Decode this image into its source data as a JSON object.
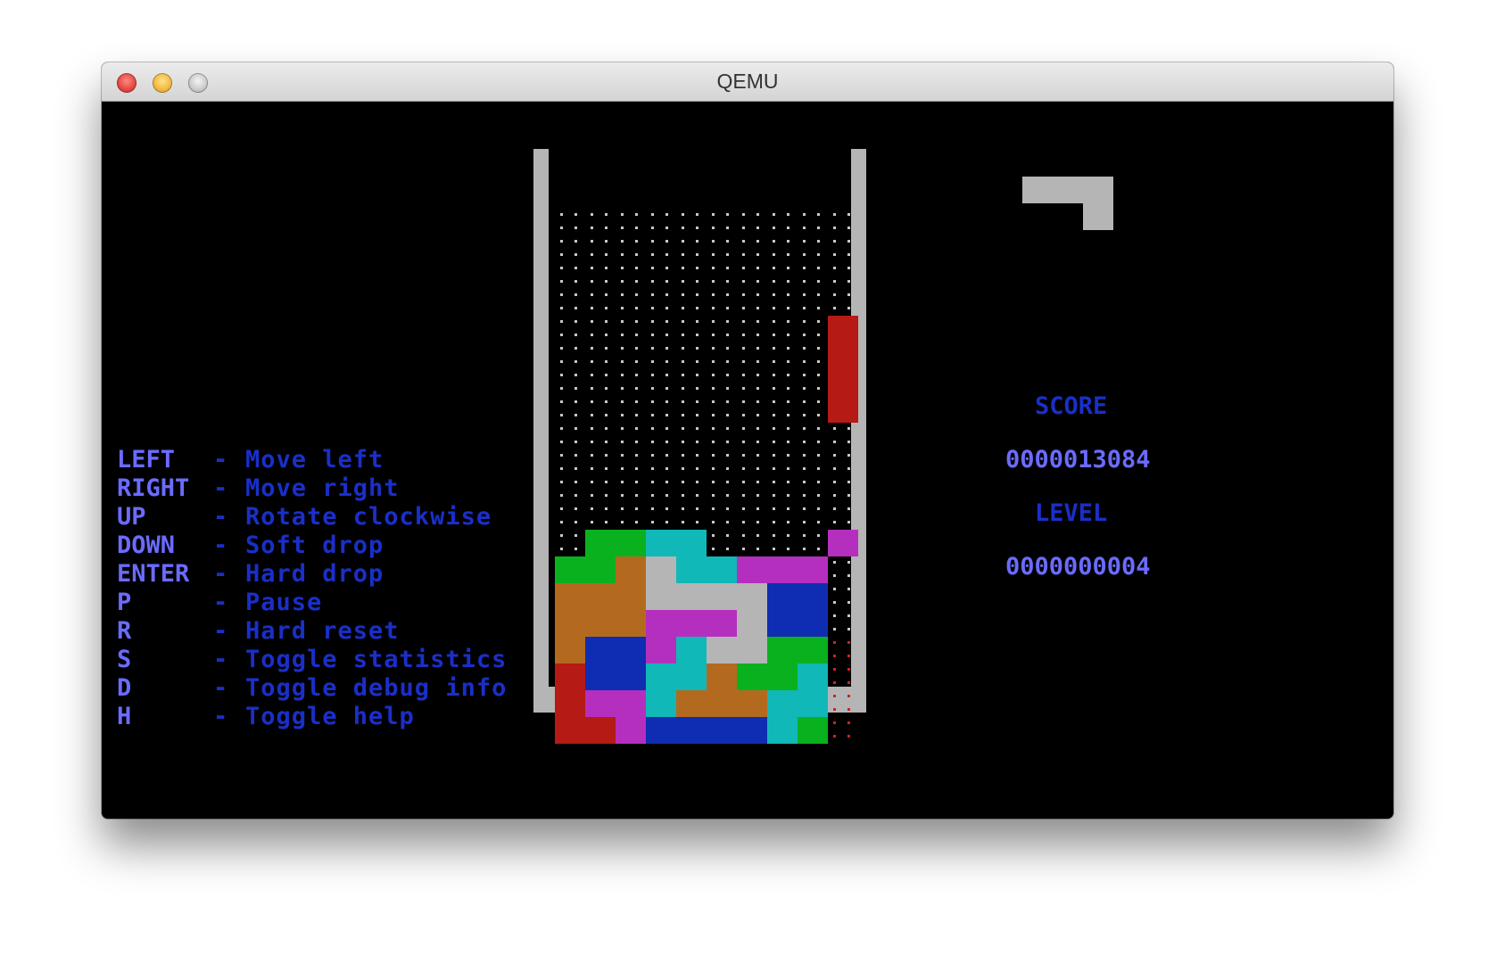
{
  "window": {
    "title": "QEMU"
  },
  "help": [
    {
      "key": "LEFT",
      "dash": "-",
      "desc": "Move left"
    },
    {
      "key": "RIGHT",
      "dash": "-",
      "desc": "Move right"
    },
    {
      "key": "UP",
      "dash": "-",
      "desc": "Rotate clockwise"
    },
    {
      "key": "DOWN",
      "dash": "-",
      "desc": "Soft drop"
    },
    {
      "key": "ENTER",
      "dash": "-",
      "desc": "Hard drop"
    },
    {
      "key": "P",
      "dash": "-",
      "desc": "Pause"
    },
    {
      "key": "R",
      "dash": "-",
      "desc": "Hard reset"
    },
    {
      "key": "S",
      "dash": "-",
      "desc": "Toggle statistics"
    },
    {
      "key": "D",
      "dash": "-",
      "desc": "Toggle debug info"
    },
    {
      "key": "H",
      "dash": "-",
      "desc": "Toggle help"
    }
  ],
  "stats": {
    "score_label": "SCORE",
    "score_value": "0000013084",
    "level_label": "LEVEL",
    "level_value": "0000000004"
  },
  "colors": {
    "border": "#b5b5b5",
    "dot": "#c8c8c8",
    "ghost_dot": "#d42020",
    "G": "#0ab11e",
    "C": "#10b8b8",
    "M": "#b52fbe",
    "O": "#b46a1e",
    "W": "#b5b5b5",
    "B": "#0f2db2",
    "R": "#b51a14"
  },
  "board": {
    "columns": 10,
    "rows": 20,
    "cells": [
      "..........",
      "..........",
      "..........",
      "..........",
      "..........",
      "..........",
      "..........",
      "..........",
      "..........",
      "..........",
      "..........",
      "..........",
      ".GGCC....M",
      "GGOWCCMMM.",
      "OOOWWWWBB.",
      "OOOMMMWBB.",
      "OBBMCWWGG.",
      "RBBCCOGGC.",
      "RMMCOOOCC.",
      "RRMBBBBCG."
    ],
    "active_piece": {
      "color": "R",
      "cells": [
        [
          4,
          9
        ],
        [
          5,
          9
        ],
        [
          6,
          9
        ],
        [
          7,
          9
        ]
      ]
    },
    "ghost_piece": {
      "color": "ghost_dot",
      "cells": [
        [
          16,
          9
        ],
        [
          17,
          9
        ],
        [
          18,
          9
        ],
        [
          19,
          9
        ]
      ]
    }
  },
  "next_piece": {
    "color": "W",
    "cells": [
      [
        0,
        0
      ],
      [
        0,
        1
      ],
      [
        0,
        2
      ],
      [
        1,
        2
      ]
    ]
  }
}
